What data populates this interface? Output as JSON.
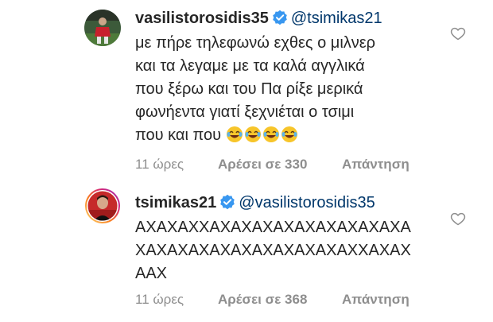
{
  "comments": [
    {
      "username": "vasilistorosidis35",
      "mention": "@tsimikas21",
      "lines": [
        "με πήρε τηλεφωνώ εχθες ο μιλνερ",
        "και τα λεγαμε με τα καλά αγγλικά",
        "που ξέρω και του Πα ρίξε μερικά",
        "φωνήεντα γιατί ξεχνιέται ο τσιμι",
        "που και που"
      ],
      "emoji": "face-with-tears-of-joy x4",
      "time": "11 ώρες",
      "likes": "Αρέσει σε 330",
      "reply": "Απάντηση",
      "verified_color": "#3897f0"
    },
    {
      "username": "tsimikas21",
      "mention": "@vasilistorosidis35",
      "lines": [
        "ΑΧΑΧΑΧΧΑΧΑΧΑΧΑΧΑΧΑΧΑΧΑΧΑΧΑ",
        "ΧΑΧΑΧΑΧΑΧΑΧΑΧΑΧΑΧΑΧΑΧΧΑΧΑΧ",
        "ΑΑΧ"
      ],
      "time": "11 ώρες",
      "likes": "Αρέσει σε 368",
      "reply": "Απάντηση",
      "verified_color": "#3897f0"
    }
  ],
  "icons": {
    "verified": "verified-badge-icon",
    "like": "heart-outline-icon",
    "avatar_story_ring": "#d62976"
  }
}
